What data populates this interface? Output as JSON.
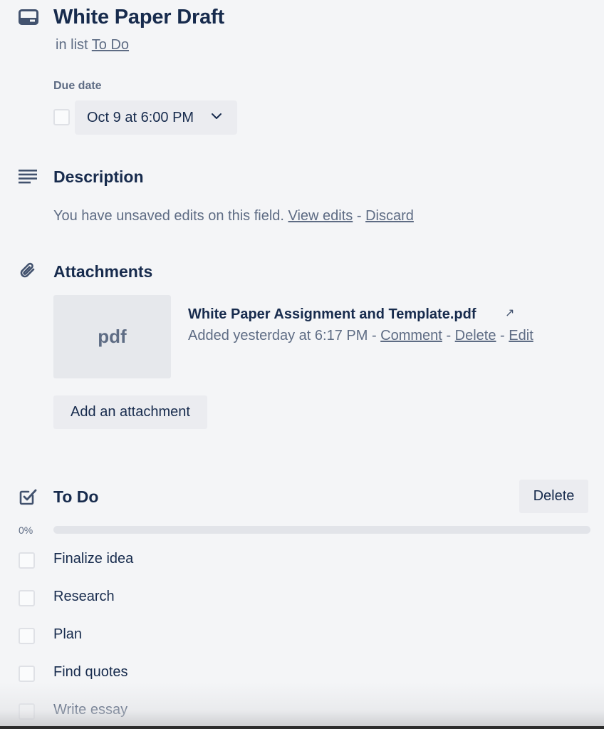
{
  "card": {
    "title": "White Paper Draft",
    "in_list_prefix": "in list",
    "list_name": "To Do"
  },
  "due": {
    "label": "Due date",
    "value": "Oct 9 at 6:00 PM",
    "completed": false
  },
  "description": {
    "heading": "Description",
    "notice": "You have unsaved edits on this field.",
    "view_edits": "View edits",
    "separator": "-",
    "discard": "Discard"
  },
  "attachments": {
    "heading": "Attachments",
    "items": [
      {
        "thumb_label": "pdf",
        "name": "White Paper Assignment and Template.pdf",
        "external_glyph": "↗",
        "added": "Added yesterday at 6:17 PM",
        "comment": "Comment",
        "delete": "Delete",
        "edit": "Edit"
      }
    ],
    "add_label": "Add an attachment"
  },
  "checklist": {
    "heading": "To Do",
    "delete_label": "Delete",
    "progress_text": "0%",
    "progress": 0,
    "items": [
      {
        "label": "Finalize idea",
        "checked": false
      },
      {
        "label": "Research",
        "checked": false
      },
      {
        "label": "Plan",
        "checked": false
      },
      {
        "label": "Find quotes",
        "checked": false
      },
      {
        "label": "Write essay",
        "checked": false
      }
    ]
  },
  "colors": {
    "background": "#f4f5f7",
    "text_primary": "#172b4d",
    "text_subtle": "#5e6c84",
    "button_bg": "#ebecf0",
    "progress_track": "#e2e4e9"
  },
  "icons": {
    "card": "card-icon",
    "description": "description-icon",
    "attachment": "paperclip-icon",
    "checklist": "checklist-icon",
    "chevron": "chevron-down-icon",
    "external": "external-link-icon"
  }
}
